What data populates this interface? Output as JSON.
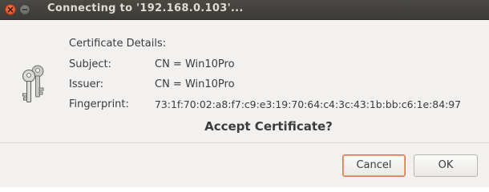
{
  "window": {
    "title": "Connecting to '192.168.0.103'..."
  },
  "dialog": {
    "heading": "Certificate Details:",
    "fields": [
      {
        "label": "Subject:",
        "value": "CN = Win10Pro"
      },
      {
        "label": "Issuer:",
        "value": "CN = Win10Pro"
      },
      {
        "label": "Fingerprint:",
        "value": "73:1f:70:02:a8:f7:c9:e3:19:70:64:c4:3c:43:1b:bb:c6:1e:84:97"
      }
    ],
    "question": "Accept Certificate?",
    "icon": "keys-icon"
  },
  "buttons": {
    "cancel": "Cancel",
    "ok": "OK"
  },
  "colors": {
    "titlebar": "#3c3b37",
    "close_button": "#e15a2d",
    "focus_border": "#e46d42",
    "background": "#f2f1f0"
  }
}
